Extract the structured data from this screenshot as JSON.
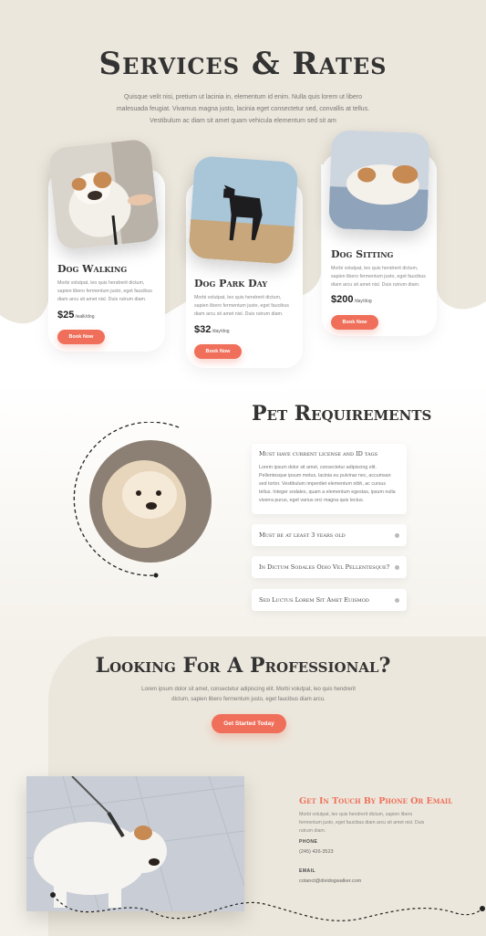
{
  "services": {
    "title": "Services & Rates",
    "intro": "Quisque velit nisi, pretium ut lacinia in, elementum id enim. Nulla quis lorem ut libero malesuada feugiat. Vivamus magna justo, lacinia eget consectetur sed, convallis at tellus. Vestibulum ac diam sit amet quam vehicula elementum sed sit am",
    "cards": [
      {
        "title": "Dog Walking",
        "text": "Morbi volutpat, leo quis hendrerit dictum, sapien libero fermentum justo, eget faucibus diam arcu sit amet nisl. Duis rutrum diam.",
        "price": "$25",
        "unit": "/walk/dog",
        "button": "Book Now"
      },
      {
        "title": "Dog Park Day",
        "text": "Morbi volutpat, leo quis hendrerit dictum, sapien libero fermentum justo, eget faucibus diam arcu sit amet nisl. Duis rutrum diam.",
        "price": "$32",
        "unit": "/day/dog",
        "button": "Book Now"
      },
      {
        "title": "Dog Sitting",
        "text": "Morbi volutpat, leo quis hendrerit dictum, sapien libero fermentum justo, eget faucibus diam arcu sit amet nisl. Duis rutrum diam.",
        "price": "$200",
        "unit": "/day/dog",
        "button": "Book Now"
      }
    ]
  },
  "requirements": {
    "title": "Pet Requirements",
    "items": [
      {
        "title": "Must have current license and ID tags",
        "body": "Lorem ipsum dolor sit amet, consectetur adipiscing elit. Pellentesque ipsum metus, lacinia eu pulvinar nec, accumsan sed tortor. Vestibulum imperdiet elementum nibh, ac cursus tellus. Integer sodales, quam a elementum egestas, ipsum nulla viverra purus, eget varius orci magna quis lectus."
      },
      {
        "title": "Must be at least 3 years old"
      },
      {
        "title": "In Dictum Sodales Odio Vel Pellentesque?"
      },
      {
        "title": "Sed Luctus Lorem Sit Amet Euismod"
      }
    ]
  },
  "professional": {
    "title": "Looking For A Professional?",
    "text": "Lorem ipsum dolor sit amet, consectetur adipiscing elit. Morbi volutpat, leo quis hendrerit dictum, sapien libero fermentum justo, eget faucibus diam arcu.",
    "button": "Get Started Today"
  },
  "contact": {
    "heading": "Get In Touch By Phone Or Email",
    "text": "Morbi volutpat, leo quis hendrerit dictum, sapien libero fermentum justo, eget faucibus diam arcu sit amet nisl. Duis rutrum diam.",
    "phone_label": "PHONE",
    "phone": "(245) 426-3523",
    "email_label": "EMAIL",
    "email": "cotanct@dividogwalker.com"
  },
  "colors": {
    "accent": "#ef6f5a",
    "beige": "#ece7dc",
    "heading": "#333333"
  }
}
